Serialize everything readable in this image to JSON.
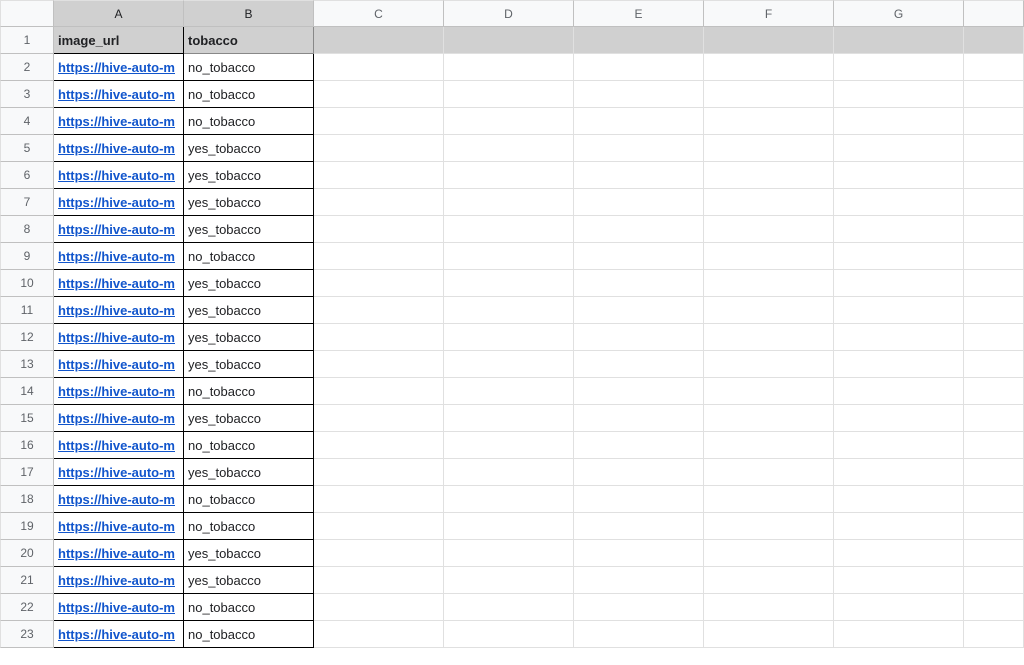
{
  "columns": [
    "A",
    "B",
    "C",
    "D",
    "E",
    "F",
    "G"
  ],
  "header": {
    "A": "image_url",
    "B": "tobacco"
  },
  "rows": [
    {
      "n": 2,
      "A": "https://hive-auto-m",
      "B": "no_tobacco"
    },
    {
      "n": 3,
      "A": "https://hive-auto-m",
      "B": "no_tobacco"
    },
    {
      "n": 4,
      "A": "https://hive-auto-m",
      "B": "no_tobacco"
    },
    {
      "n": 5,
      "A": "https://hive-auto-m",
      "B": "yes_tobacco"
    },
    {
      "n": 6,
      "A": "https://hive-auto-m",
      "B": "yes_tobacco"
    },
    {
      "n": 7,
      "A": "https://hive-auto-m",
      "B": "yes_tobacco"
    },
    {
      "n": 8,
      "A": "https://hive-auto-m",
      "B": "yes_tobacco"
    },
    {
      "n": 9,
      "A": "https://hive-auto-m",
      "B": "no_tobacco"
    },
    {
      "n": 10,
      "A": "https://hive-auto-m",
      "B": "yes_tobacco"
    },
    {
      "n": 11,
      "A": "https://hive-auto-m",
      "B": "yes_tobacco"
    },
    {
      "n": 12,
      "A": "https://hive-auto-m",
      "B": "yes_tobacco"
    },
    {
      "n": 13,
      "A": "https://hive-auto-m",
      "B": "yes_tobacco"
    },
    {
      "n": 14,
      "A": "https://hive-auto-m",
      "B": "no_tobacco"
    },
    {
      "n": 15,
      "A": "https://hive-auto-m",
      "B": "yes_tobacco"
    },
    {
      "n": 16,
      "A": "https://hive-auto-m",
      "B": "no_tobacco"
    },
    {
      "n": 17,
      "A": "https://hive-auto-m",
      "B": "yes_tobacco"
    },
    {
      "n": 18,
      "A": "https://hive-auto-m",
      "B": "no_tobacco"
    },
    {
      "n": 19,
      "A": "https://hive-auto-m",
      "B": "no_tobacco"
    },
    {
      "n": 20,
      "A": "https://hive-auto-m",
      "B": "yes_tobacco"
    },
    {
      "n": 21,
      "A": "https://hive-auto-m",
      "B": "yes_tobacco"
    },
    {
      "n": 22,
      "A": "https://hive-auto-m",
      "B": "no_tobacco"
    },
    {
      "n": 23,
      "A": "https://hive-auto-m",
      "B": "no_tobacco"
    }
  ]
}
